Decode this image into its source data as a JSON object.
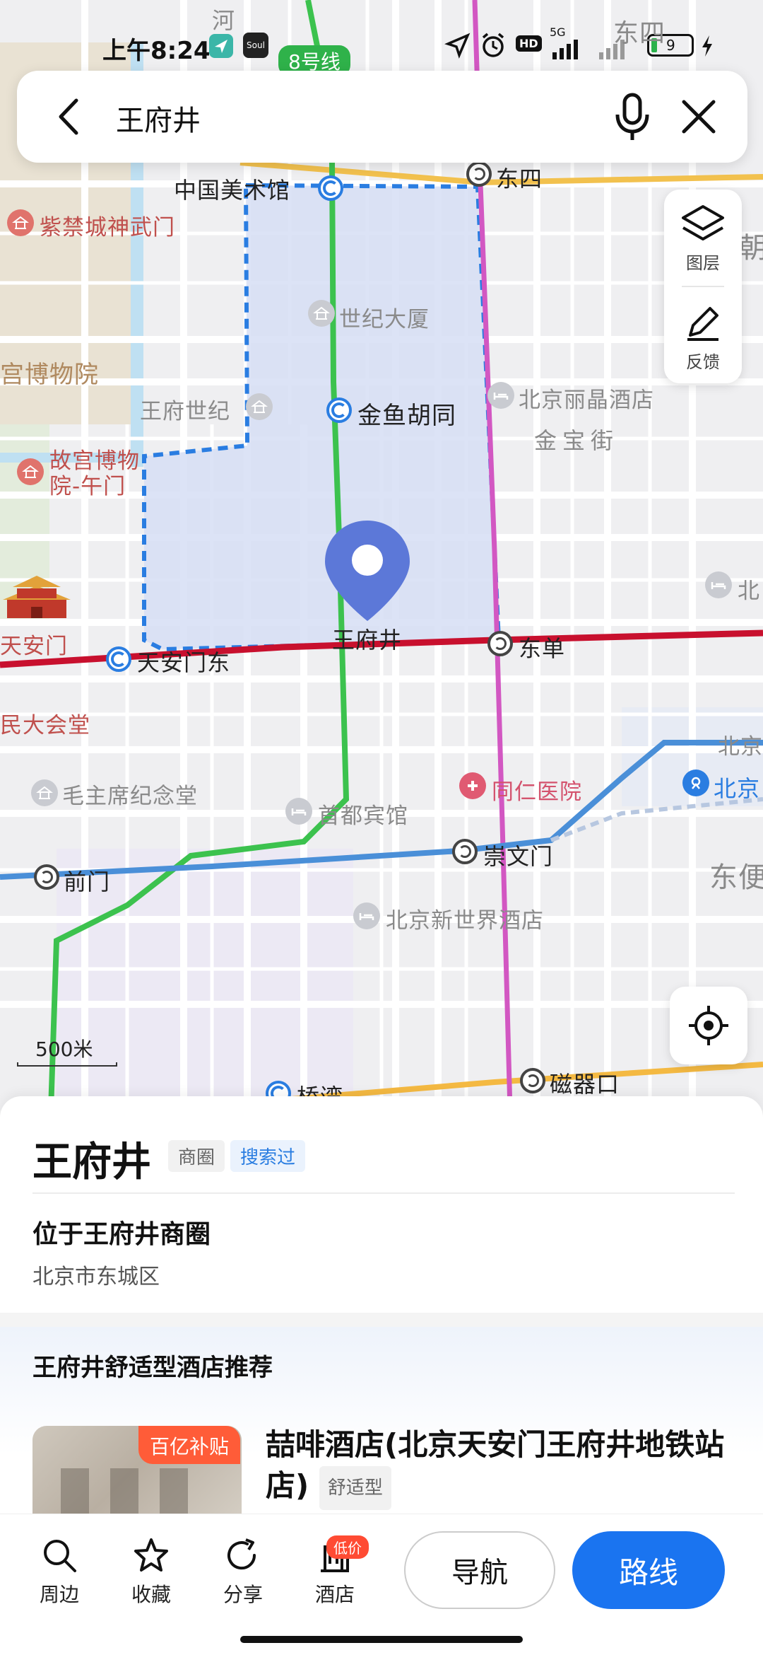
{
  "status_bar": {
    "time": "上午8:24",
    "app_icon_label": "Soul",
    "network": "5G",
    "hd": "HD",
    "battery": "9"
  },
  "search": {
    "query": "王府井"
  },
  "map": {
    "line_badge": "8号线",
    "labels": {
      "river": "河",
      "dongsi_top": "东四",
      "art_museum": "中国美术馆",
      "dongsi": "东四",
      "shenwumen": "紫禁城神武门",
      "palace_museum": "宫博物院",
      "century_building": "世纪大厦",
      "wfj_century": "王府世纪",
      "jinyu_hutong": "金鱼胡同",
      "regent_hotel": "北京丽晶酒店",
      "jinbao_street": "金宝街",
      "wumen": "故宫博物院-午门",
      "wangfujing": "王府井",
      "dongdan": "东单",
      "tiananmen": "天安门",
      "tiananmen_east": "天安门东",
      "great_hall": "民大会堂",
      "mausoleum": "毛主席纪念堂",
      "capital_hotel": "首都宾馆",
      "tongren_hospital": "同仁医院",
      "beijing_station_short": "北京",
      "beijing_station_north": "北京",
      "chongwenmen": "崇文门",
      "qianmen": "前门",
      "dongbian": "东便",
      "newworld_hotel": "北京新世界酒店",
      "qiaowan": "桥湾",
      "ciqikou": "磁器口",
      "chao": "朝",
      "north_right": "北"
    },
    "layer_label": "图层",
    "feedback_label": "反馈",
    "scale_label": "500米"
  },
  "place": {
    "title": "王府井",
    "tag_category": "商圈",
    "tag_searched": "搜索过",
    "location_title": "位于王府井商圈",
    "district": "北京市东城区"
  },
  "recommend": {
    "title": "王府井舒适型酒店推荐",
    "hotel_badge": "百亿补贴",
    "hotel_name": "喆啡酒店(北京天安门王府井地铁站店)",
    "hotel_type": "舒适型"
  },
  "bottom_bar": {
    "nearby": "周边",
    "favorite": "收藏",
    "share": "分享",
    "hotel": "酒店",
    "hotel_badge": "低价",
    "navigate": "导航",
    "route": "路线"
  },
  "colors": {
    "accent_blue": "#1a74f0",
    "line_green": "#3cc24e",
    "line_red": "#c8102e",
    "line_pink": "#d257c2",
    "line_blue": "#4a8fd8",
    "area_fill": "#d6def5"
  }
}
